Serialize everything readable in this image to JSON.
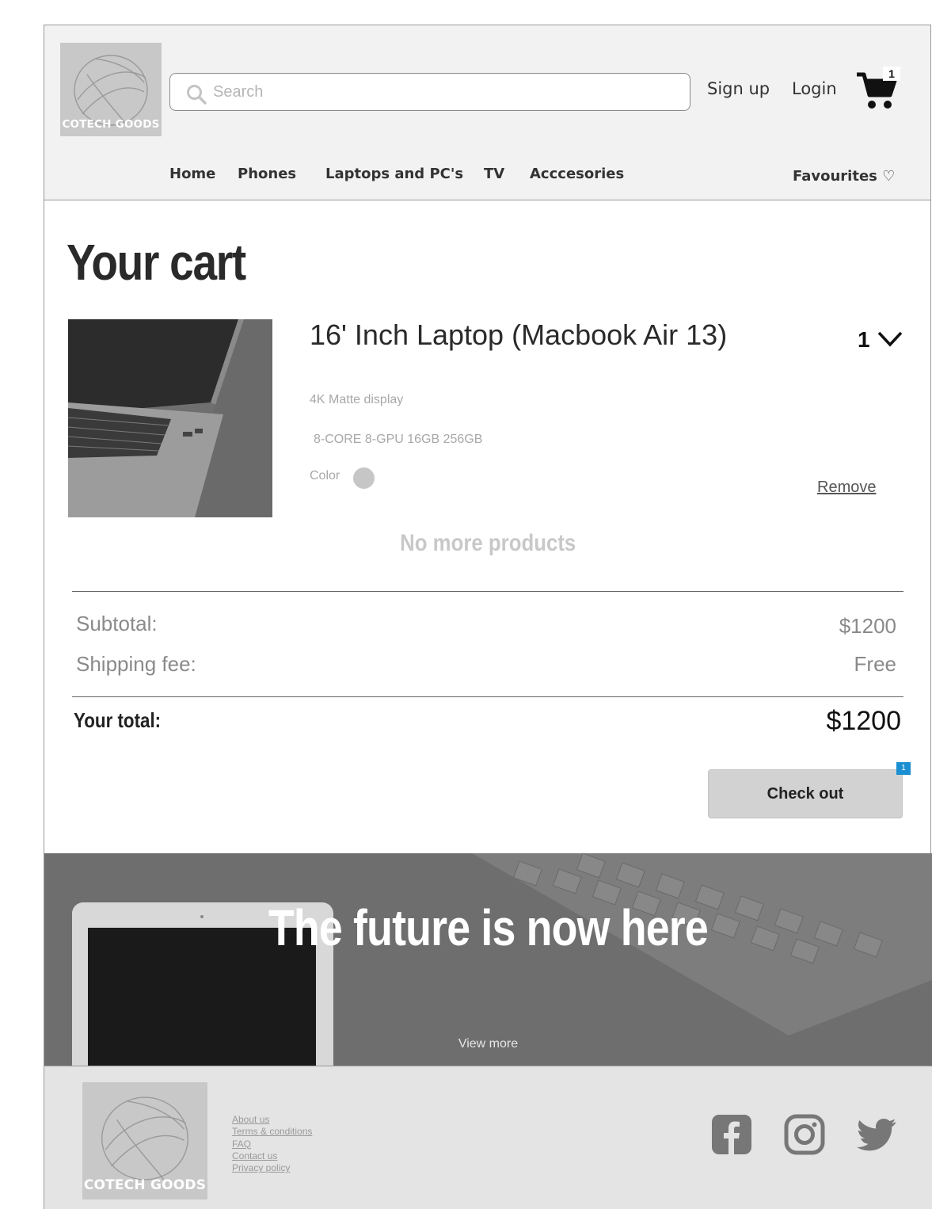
{
  "brand": {
    "logo_text": "COTECH GOODS"
  },
  "header": {
    "search_placeholder": "Search",
    "signup_label": "Sign up",
    "login_label": "Login",
    "cart_count": "1"
  },
  "nav": {
    "items": [
      "Home",
      "Phones",
      "Laptops and PC's",
      "TV",
      "Acccesories"
    ],
    "favourites_label": "Favourites ♡"
  },
  "cart": {
    "title": "Your cart",
    "item": {
      "name": "16' Inch Laptop (Macbook Air 13)",
      "quantity": "1",
      "spec_display": "4K Matte display",
      "spec_hardware": "8-CORE 8-GPU 16GB 256GB",
      "color_label": "Color",
      "color_value": "#c6c6c6",
      "remove_label": "Remove"
    },
    "no_more_label": "No more products",
    "subtotal_label": "Subtotal:",
    "subtotal_value": "$1200",
    "shipping_label": "Shipping fee:",
    "shipping_value": "Free",
    "total_label": "Your total:",
    "total_value": "$1200",
    "checkout_label": "Check out",
    "annotation_badge": "1"
  },
  "banner": {
    "title": "The future is now here",
    "view_more_label": "View more"
  },
  "footer": {
    "links": [
      "About us",
      "Terms & conditions",
      "FAQ",
      "Contact us",
      "Privacy policy"
    ],
    "social": [
      "facebook-icon",
      "instagram-icon",
      "twitter-icon"
    ]
  },
  "colors": {
    "header_bg": "#f2f2f2",
    "footer_bg": "#e4e4e4",
    "badge_blue": "#1b8fd1",
    "button_bg": "#d2d2d2"
  }
}
